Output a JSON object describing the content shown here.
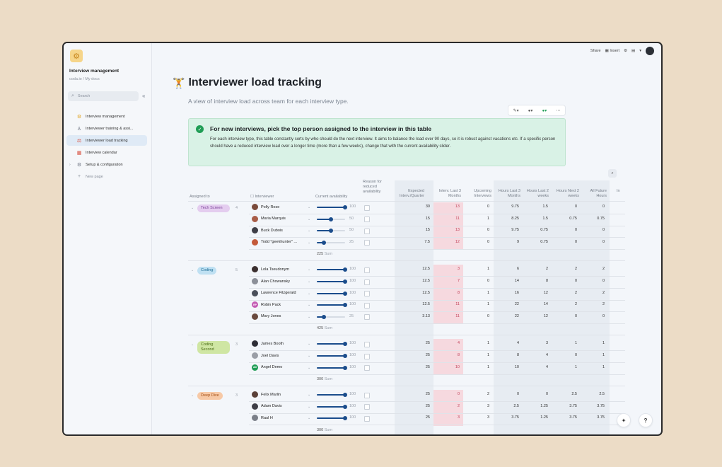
{
  "sidebar": {
    "doc_title": "Interview management",
    "doc_path": "coda.io / My docs",
    "search_placeholder": "Search",
    "items": [
      {
        "label": "Interview management",
        "icon": "gear-icon",
        "glyph": "⚙",
        "color": "#e0a21f"
      },
      {
        "label": "Interviewer training & assi...",
        "icon": "person-icon",
        "glyph": "♙",
        "color": "#6b7280"
      },
      {
        "label": "Interviewer load tracking",
        "icon": "weightlifter-icon",
        "glyph": "⚖",
        "color": "#d84f3f"
      },
      {
        "label": "Interview calendar",
        "icon": "calendar-icon",
        "glyph": "▦",
        "color": "#d84f3f"
      },
      {
        "label": "Setup & configuration",
        "icon": "gear-icon",
        "glyph": "⚙",
        "color": "#6b7280"
      }
    ],
    "new_page": "New page"
  },
  "topbar": {
    "share": "Share",
    "insert": "Insert"
  },
  "page": {
    "title": "Interviewer load tracking",
    "subtitle": "A view of interview load across team for each interview type."
  },
  "callout": {
    "title": "For new interviews, pick the top person assigned to the interview in this table",
    "body": "For each interview type, this table constantly sorts by who should do the next interview. It aims to balance the load over 90 days, so it is robust against vacations etc. If a specific person should have a reduced interview load over a longer time (more than a few weeks), change that with the current availability slider."
  },
  "table": {
    "headers": {
      "assigned_to": "Assigned to",
      "interviewer": "Interviewer",
      "current_availability": "Current availability",
      "reason": "Reason for reduced availability",
      "expected": "Expected Interv./Quarter",
      "interv_last": "Interv. Last 3 Months",
      "upcoming": "Upcoming Interviews",
      "hours_last_3m": "Hours Last 3 Months",
      "hours_last_2w": "Hours Last 2 weeks",
      "hours_next_2w": "Hours Next 2 weeks",
      "all_future": "All Future Hours",
      "extra": "In"
    },
    "sum_label": "Sum",
    "groups": [
      {
        "name": "Tech Screen",
        "count": "4",
        "bg": "#e4cdef",
        "fg": "#7a3f98",
        "sum": "225",
        "rows": [
          {
            "name": "Polly Rose",
            "avail": "100",
            "pct": 100,
            "expected": "30",
            "interv": "13",
            "upcoming": "0",
            "h3m": "9.75",
            "h2w": "1.5",
            "n2w": "0",
            "future": "0",
            "av": "#7a4a3a"
          },
          {
            "name": "Maria Marquis",
            "avail": "50",
            "pct": 50,
            "expected": "15",
            "interv": "11",
            "upcoming": "1",
            "h3m": "8.25",
            "h2w": "1.5",
            "n2w": "0.75",
            "future": "0.75",
            "av": "#a85c46"
          },
          {
            "name": "Buck Dubois",
            "avail": "50",
            "pct": 50,
            "expected": "15",
            "interv": "13",
            "upcoming": "0",
            "h3m": "9.75",
            "h2w": "0.75",
            "n2w": "0",
            "future": "0",
            "av": "#3e3e46"
          },
          {
            "name": "Todd \"geekhunter\" ...",
            "avail": "25",
            "pct": 25,
            "expected": "7.5",
            "interv": "12",
            "upcoming": "0",
            "h3m": "9",
            "h2w": "0.75",
            "n2w": "0",
            "future": "0",
            "av": "#c45a3a"
          }
        ]
      },
      {
        "name": "Coding",
        "count": "5",
        "bg": "#bfe0f2",
        "fg": "#1f6e95",
        "sum": "425",
        "rows": [
          {
            "name": "Lola Tseudonym",
            "avail": "100",
            "pct": 100,
            "expected": "12.5",
            "interv": "3",
            "upcoming": "1",
            "h3m": "6",
            "h2w": "2",
            "n2w": "2",
            "future": "2",
            "av": "#3b2f2f"
          },
          {
            "name": "Alan Chowansky",
            "avail": "100",
            "pct": 100,
            "expected": "12.5",
            "interv": "7",
            "upcoming": "0",
            "h3m": "14",
            "h2w": "8",
            "n2w": "0",
            "future": "0",
            "av": "#8b8f98"
          },
          {
            "name": "Lawrence Fitzgerald",
            "avail": "100",
            "pct": 100,
            "expected": "12.5",
            "interv": "8",
            "upcoming": "1",
            "h3m": "16",
            "h2w": "12",
            "n2w": "2",
            "future": "2",
            "av": "#4a4f5a"
          },
          {
            "name": "Robin Pack",
            "avail": "100",
            "pct": 100,
            "expected": "12.5",
            "interv": "11",
            "upcoming": "1",
            "h3m": "22",
            "h2w": "14",
            "n2w": "2",
            "future": "2",
            "av": "#c45ab3",
            "initials": "RP"
          },
          {
            "name": "Mary Jones",
            "avail": "25",
            "pct": 25,
            "expected": "3.13",
            "interv": "11",
            "upcoming": "0",
            "h3m": "22",
            "h2w": "12",
            "n2w": "0",
            "future": "0",
            "av": "#6a4a3e"
          }
        ]
      },
      {
        "name": "Coding Second",
        "count": "3",
        "bg": "#cfe6a3",
        "fg": "#4a6b14",
        "sum": "300",
        "rows": [
          {
            "name": "James Booth",
            "avail": "100",
            "pct": 100,
            "expected": "25",
            "interv": "4",
            "upcoming": "1",
            "h3m": "4",
            "h2w": "3",
            "n2w": "1",
            "future": "1",
            "av": "#2e2e36"
          },
          {
            "name": "Joel Davis",
            "avail": "100",
            "pct": 100,
            "expected": "25",
            "interv": "8",
            "upcoming": "1",
            "h3m": "8",
            "h2w": "4",
            "n2w": "0",
            "future": "1",
            "av": "#9a9ea6"
          },
          {
            "name": "Angel Demo",
            "avail": "100",
            "pct": 100,
            "expected": "25",
            "interv": "10",
            "upcoming": "1",
            "h3m": "10",
            "h2w": "4",
            "n2w": "1",
            "future": "1",
            "av": "#1f9d55",
            "initials": "AD"
          }
        ]
      },
      {
        "name": "Deep Dive",
        "count": "3",
        "bg": "#f7c9a6",
        "fg": "#a24d12",
        "sum": "300",
        "rows": [
          {
            "name": "Felix Marlin",
            "avail": "100",
            "pct": 100,
            "expected": "25",
            "interv": "0",
            "upcoming": "2",
            "h3m": "0",
            "h2w": "0",
            "n2w": "2.5",
            "future": "2.5",
            "av": "#5a4038"
          },
          {
            "name": "Adam Davis",
            "avail": "100",
            "pct": 100,
            "expected": "25",
            "interv": "2",
            "upcoming": "3",
            "h3m": "2.5",
            "h2w": "1.25",
            "n2w": "3.75",
            "future": "3.75",
            "av": "#3e3e46"
          },
          {
            "name": "Raul H",
            "avail": "100",
            "pct": 100,
            "expected": "25",
            "interv": "3",
            "upcoming": "3",
            "h3m": "3.75",
            "h2w": "1.25",
            "n2w": "3.75",
            "future": "3.75",
            "av": "#7a7f88"
          }
        ]
      }
    ]
  },
  "help_label": "?"
}
